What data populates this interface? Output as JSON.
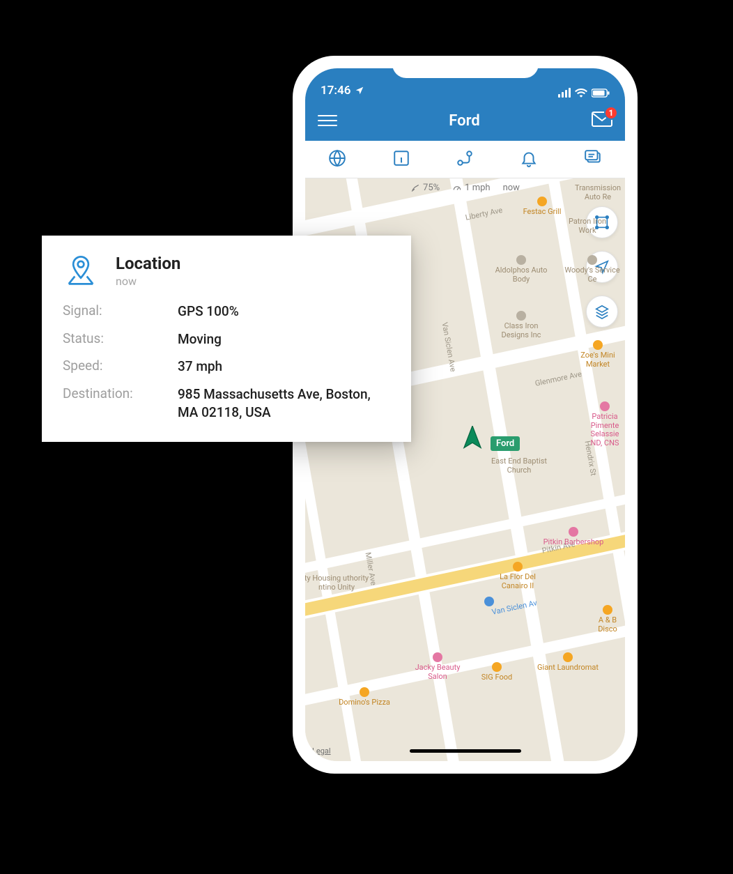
{
  "status_bar": {
    "time": "17:46",
    "location_services": true
  },
  "nav": {
    "title": "Ford",
    "notification_count": "1"
  },
  "tabs": {
    "globe": "globe-icon",
    "info": "info-icon",
    "route": "route-icon",
    "bell": "bell-icon",
    "chat": "chat-icon"
  },
  "map_overlay": {
    "satellite_pct": "75%",
    "speed": "1 mph",
    "timestamp": "now"
  },
  "map": {
    "legal": "Legal",
    "vehicle_label": "Ford",
    "roads": [
      "Liberty Ave",
      "Van Siclen Ave",
      "Miller Ave",
      "Hendrix St",
      "Glenmore Ave",
      "Van Siclen Av",
      "Pitkin Ave"
    ],
    "pois": {
      "transmission": "Transmission Auto Re",
      "festac": "Festac Grill",
      "patron": "Patron Iron Work",
      "aldolphos": "Aldolphos Auto Body",
      "woodys": "Woody's Service Ce",
      "classiron": "Class Iron Designs Inc",
      "zoes": "Zoe's Mini Market",
      "patricia": "Patricia Pimente Selassie ND, CNS",
      "eastend": "East End Baptist Church",
      "pitkin_barber": "Pitkin Barbershop",
      "laflor": "La Flor Del Canairo II",
      "housing": "ty Housing uthority ntino Unity",
      "ab": "A & B Disco",
      "jacky": "Jacky Beauty Salon",
      "sig": "SIG Food",
      "giant": "Giant Laundromat",
      "dominos": "Domino's Pizza"
    }
  },
  "location_card": {
    "title": "Location",
    "timestamp": "now",
    "labels": {
      "signal": "Signal:",
      "status": "Status:",
      "speed": "Speed:",
      "destination": "Destination:"
    },
    "values": {
      "signal": "GPS 100%",
      "status": "Moving",
      "speed": "37 mph",
      "destination": "985 Massachusetts Ave, Boston, MA 02118, USA"
    }
  },
  "colors": {
    "primary": "#2a7fc0",
    "badge": "#ff3b30",
    "vehicle": "#0b8a5a"
  }
}
